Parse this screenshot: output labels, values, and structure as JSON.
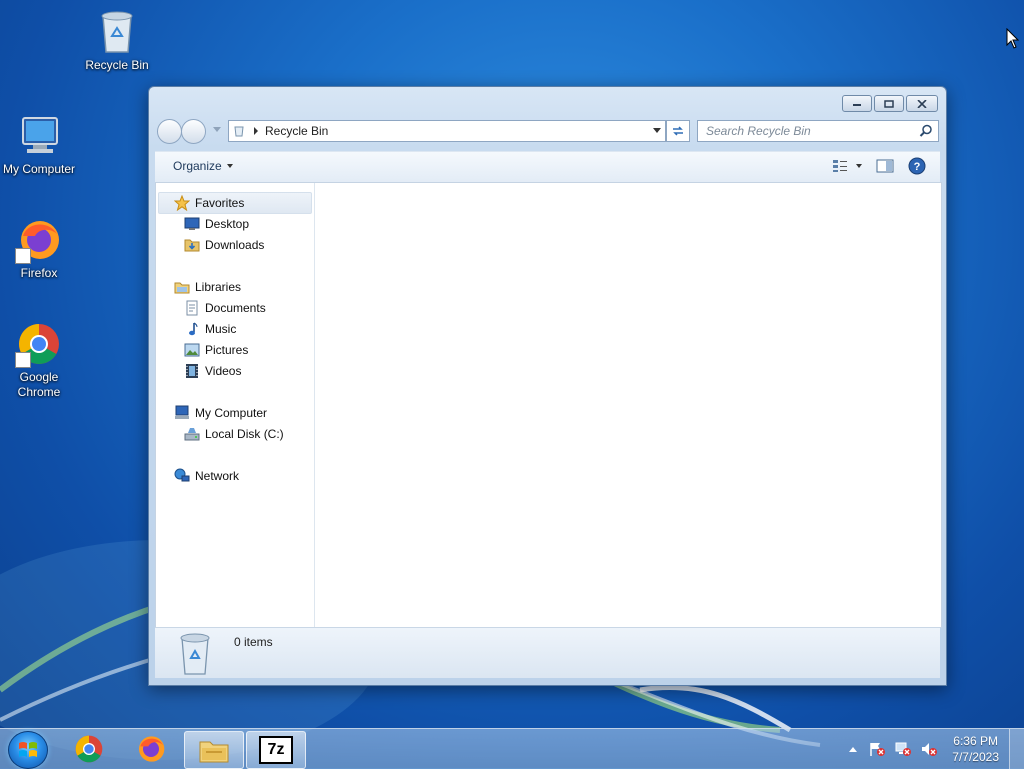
{
  "desktop": {
    "icons": [
      {
        "label": "Recycle Bin",
        "icon": "recycle-bin-icon"
      },
      {
        "label": "My Computer",
        "icon": "computer-icon"
      },
      {
        "label": "Firefox",
        "icon": "firefox-icon"
      },
      {
        "label": "Google Chrome",
        "icon": "chrome-icon"
      }
    ]
  },
  "window": {
    "address": {
      "path": "Recycle Bin"
    },
    "search": {
      "placeholder": "Search Recycle Bin"
    },
    "toolbar": {
      "organize_label": "Organize"
    },
    "sidebar": {
      "items": [
        {
          "label": "Favorites",
          "icon": "star-icon"
        },
        {
          "label": "Desktop",
          "icon": "desktop-icon"
        },
        {
          "label": "Downloads",
          "icon": "downloads-icon"
        },
        {
          "label": "Libraries",
          "icon": "libraries-icon"
        },
        {
          "label": "Documents",
          "icon": "documents-icon"
        },
        {
          "label": "Music",
          "icon": "music-icon"
        },
        {
          "label": "Pictures",
          "icon": "pictures-icon"
        },
        {
          "label": "Videos",
          "icon": "videos-icon"
        },
        {
          "label": "My Computer",
          "icon": "computer-icon"
        },
        {
          "label": "Local Disk (C:)",
          "icon": "drive-icon"
        },
        {
          "label": "Network",
          "icon": "network-icon"
        }
      ]
    },
    "details": {
      "item_count": "0 items"
    }
  },
  "taskbar": {
    "apps": [
      {
        "name": "Google Chrome",
        "icon": "chrome-icon"
      },
      {
        "name": "Firefox",
        "icon": "firefox-icon"
      },
      {
        "name": "Windows Explorer",
        "icon": "explorer-icon"
      },
      {
        "name": "7-Zip",
        "icon": "7zip-icon",
        "text": "7z"
      }
    ],
    "clock": {
      "time": "6:36 PM",
      "date": "7/7/2023"
    }
  }
}
